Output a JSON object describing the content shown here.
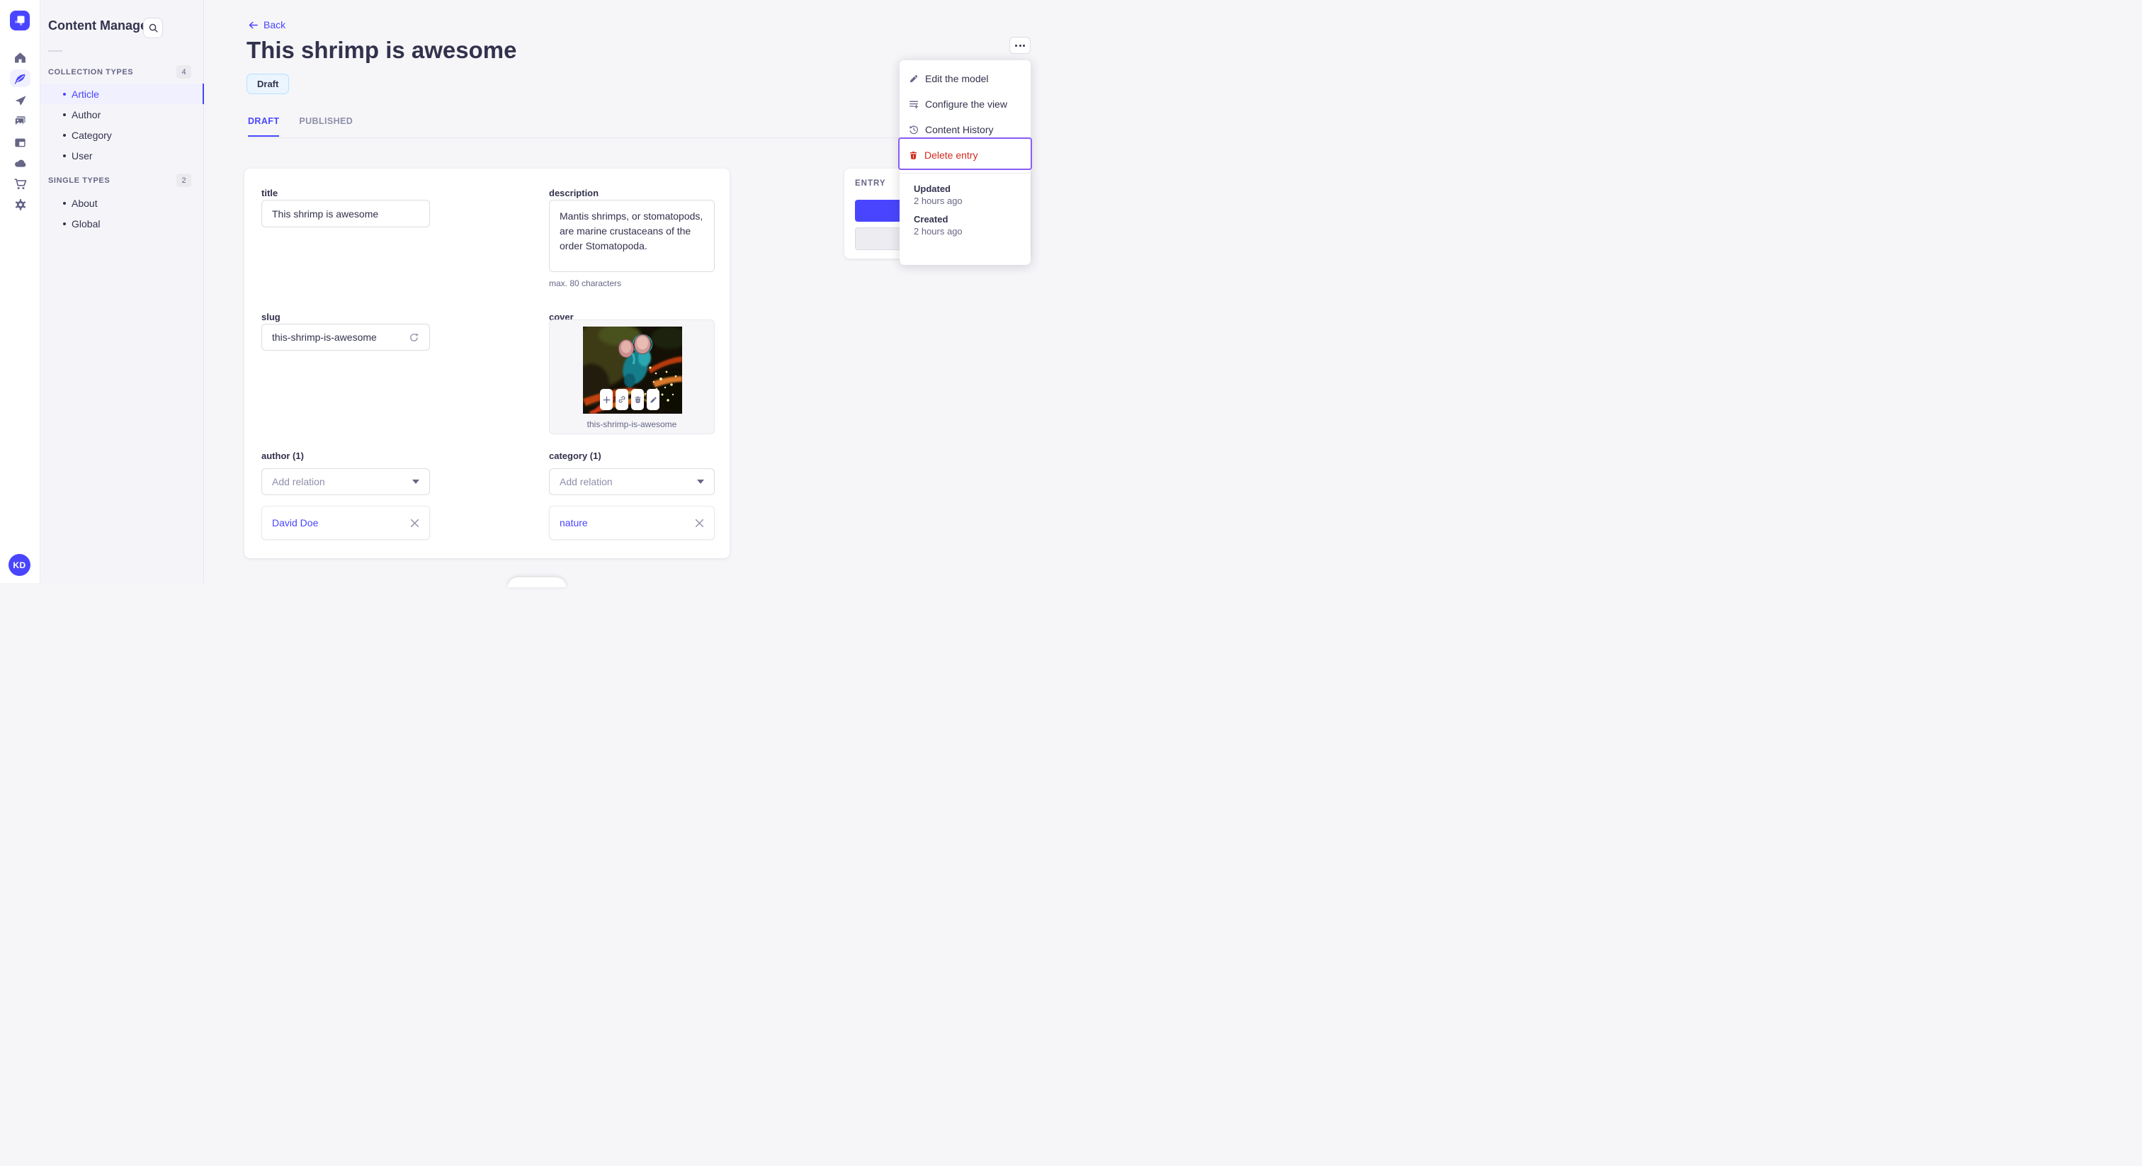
{
  "app": {
    "name": "Content Manager"
  },
  "nav_rail": {
    "avatar_initials": "KD",
    "icons": [
      "home",
      "content-manager",
      "releases",
      "media-library",
      "layouts",
      "deploy",
      "marketplace",
      "settings"
    ]
  },
  "sidebar": {
    "title": "Content Manager",
    "sections": [
      {
        "label": "COLLECTION TYPES",
        "count": "4",
        "items": [
          {
            "label": "Article",
            "active": true
          },
          {
            "label": "Author"
          },
          {
            "label": "Category"
          },
          {
            "label": "User"
          }
        ]
      },
      {
        "label": "SINGLE TYPES",
        "count": "2",
        "items": [
          {
            "label": "About"
          },
          {
            "label": "Global"
          }
        ]
      }
    ]
  },
  "header": {
    "back_label": "Back",
    "title": "This shrimp is awesome",
    "status_badge": "Draft",
    "tabs": [
      {
        "label": "DRAFT",
        "active": true
      },
      {
        "label": "PUBLISHED",
        "active": false
      }
    ]
  },
  "form": {
    "title": {
      "label": "title",
      "value": "This shrimp is awesome"
    },
    "description": {
      "label": "description",
      "value": "Mantis shrimps, or stomatopods, are marine crustaceans of the order Stomatopoda.",
      "helper": "max. 80 characters"
    },
    "slug": {
      "label": "slug",
      "value": "this-shrimp-is-awesome"
    },
    "cover": {
      "label": "cover",
      "caption": "this-shrimp-is-awesome"
    },
    "author": {
      "label": "author (1)",
      "placeholder": "Add relation",
      "relation": "David Doe"
    },
    "category": {
      "label": "category (1)",
      "placeholder": "Add relation",
      "relation": "nature"
    }
  },
  "entry_panel": {
    "title": "ENTRY"
  },
  "menu": {
    "items": [
      {
        "label": "Edit the model"
      },
      {
        "label": "Configure the view"
      },
      {
        "label": "Content History"
      },
      {
        "label": "Delete entry",
        "danger": true,
        "highlighted": true
      }
    ],
    "meta": [
      {
        "label": "Updated",
        "value": "2 hours ago"
      },
      {
        "label": "Created",
        "value": "2 hours ago"
      }
    ]
  },
  "colors": {
    "primary": "#4945ff",
    "primary_light": "#f0f0ff",
    "danger": "#d02b20",
    "highlight_outline": "#8b5cf6",
    "draft_bg": "#eaf5ff",
    "draft_border": "#b8e1ff",
    "text": "#32324d",
    "text_muted": "#666687"
  }
}
